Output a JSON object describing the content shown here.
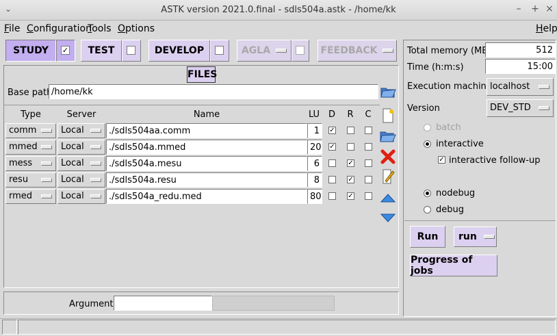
{
  "window": {
    "title": "ASTK version 2021.0.final - sdls504a.astk - /home/kk",
    "minimize": "–",
    "maximize": "+",
    "close": "×",
    "menu_icon": "chevron-down-icon"
  },
  "menubar": {
    "file": "File",
    "configuration": "Configuration",
    "tools": "Tools",
    "options": "Options",
    "help": "Help"
  },
  "modes": {
    "study": {
      "label": "STUDY",
      "checked": true
    },
    "test": {
      "label": "TEST",
      "checked": false
    },
    "develop": {
      "label": "DEVELOP",
      "checked": false
    },
    "agla": {
      "label": "AGLA",
      "checked": false,
      "disabled": true
    },
    "feedback": {
      "label": "FEEDBACK",
      "disabled": true
    }
  },
  "files": {
    "title": "FILES",
    "base_path_label": "Base path",
    "base_path": "/home/kk",
    "headers": {
      "type": "Type",
      "server": "Server",
      "name": "Name",
      "lu": "LU",
      "d": "D",
      "r": "R",
      "c": "C"
    },
    "rows": [
      {
        "type": "comm",
        "server": "Local",
        "name": "./sdls504aa.comm",
        "lu": "1",
        "d": true,
        "r": false,
        "c": false
      },
      {
        "type": "mmed",
        "server": "Local",
        "name": "./sdls504a.mmed",
        "lu": "20",
        "d": true,
        "r": false,
        "c": false
      },
      {
        "type": "mess",
        "server": "Local",
        "name": "./sdls504a.mesu",
        "lu": "6",
        "d": false,
        "r": true,
        "c": false
      },
      {
        "type": "resu",
        "server": "Local",
        "name": "./sdls504a.resu",
        "lu": "8",
        "d": false,
        "r": true,
        "c": false
      },
      {
        "type": "rmed",
        "server": "Local",
        "name": "./sdls504a_redu.med",
        "lu": "80",
        "d": false,
        "r": true,
        "c": false
      }
    ],
    "arguments_label": "Arguments",
    "arguments_value": ""
  },
  "side_icons": [
    "new-file-icon",
    "open-folder-icon",
    "delete-icon",
    "edit-icon",
    "move-up-icon",
    "move-down-icon"
  ],
  "settings": {
    "total_memory_label": "Total memory (MB)",
    "total_memory": "512",
    "time_label": "Time (h:m:s)",
    "time": "15:00",
    "exec_machine_label": "Execution machine",
    "exec_machine": "localhost",
    "version_label": "Version",
    "version": "DEV_STD",
    "batch": "batch",
    "interactive": "interactive",
    "interactive_followup": "interactive follow-up",
    "nodebug": "nodebug",
    "debug": "debug",
    "run_button": "Run",
    "run_mode": "run",
    "progress_button": "Progress of jobs"
  },
  "colors": {
    "accent": "#c3aef0",
    "button": "#dcd0f0",
    "bg": "#d9d9d9"
  }
}
